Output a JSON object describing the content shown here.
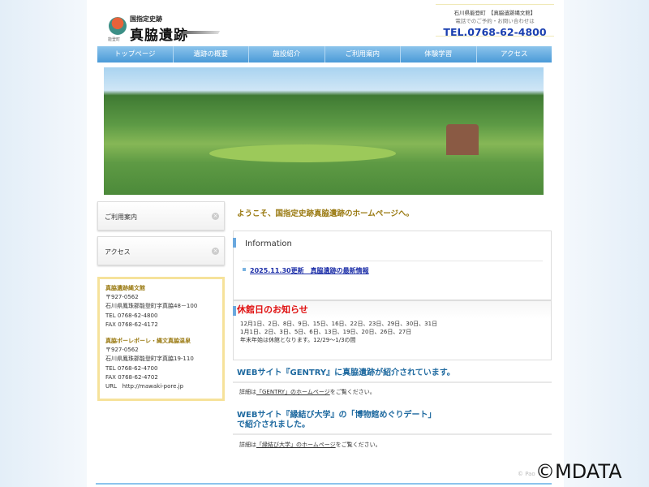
{
  "header": {
    "logo_sub": "国指定史跡",
    "logo_name": "真脇遺跡",
    "logo_town": "能登町",
    "contact_line1": "石川県能登町　【真脇遺跡縄文館】",
    "contact_line2": "電話でのご予約・お問い合わせは",
    "tel": "TEL.0768-62-4800"
  },
  "nav": [
    "トップページ",
    "遺跡の概要",
    "施設紹介",
    "ご利用案内",
    "体験学習",
    "アクセス"
  ],
  "sidebar": {
    "buttons": [
      "ご利用案内",
      "アクセス"
    ],
    "info": [
      {
        "name": "真脇遺跡縄文館",
        "zip": "〒927-0562",
        "addr": "石川県鳳珠郡能登町字真脇48－100",
        "tel": "TEL 0768-62-4800",
        "fax": "FAX 0768-62-4172"
      },
      {
        "name": "真脇ポーレポーレ・縄文真脇温泉",
        "zip": "〒927-0562",
        "addr": "石川県鳳珠郡能登町字真脇19-110",
        "tel": "TEL 0768-62-4700",
        "fax": "FAX 0768-62-4702",
        "url_label": "URL",
        "url": "http://mawaki-pore.jp"
      }
    ]
  },
  "main": {
    "welcome": "ようこそ、国指定史跡真脇遺跡のホームページへ。",
    "information_title": "Information",
    "news": "2025.11.30更新　真脇遺跡の最新情報",
    "notice_title": "休館日のお知らせ",
    "notice_lines": [
      "12月1日、2日、8日、9日、15日、16日、22日、23日、29日、30日、31日",
      "1月1日、2日、3日、5日、6日、13日、19日、20日、26日、27日",
      "年末年始は休館となります。12/29～1/3の間"
    ],
    "gentry_heading": "WEBサイト『GENTRY』に真脇遺跡が紹介されています。",
    "gentry_pre": "詳細は",
    "gentry_link": "「GENTRY」のホームページ",
    "gentry_post": "をご覧ください。",
    "enmusubi_heading1": "WEBサイト『縁結び大学』の「博物館めぐりデート」",
    "enmusubi_heading2": "で紹介されました。",
    "enmusubi_pre": "詳細は",
    "enmusubi_link": "「縁結び大学」のホームページ",
    "enmusubi_post": "をご覧ください。"
  },
  "footer": {
    "copyright": "© Pao"
  },
  "watermark": "©MDATA"
}
